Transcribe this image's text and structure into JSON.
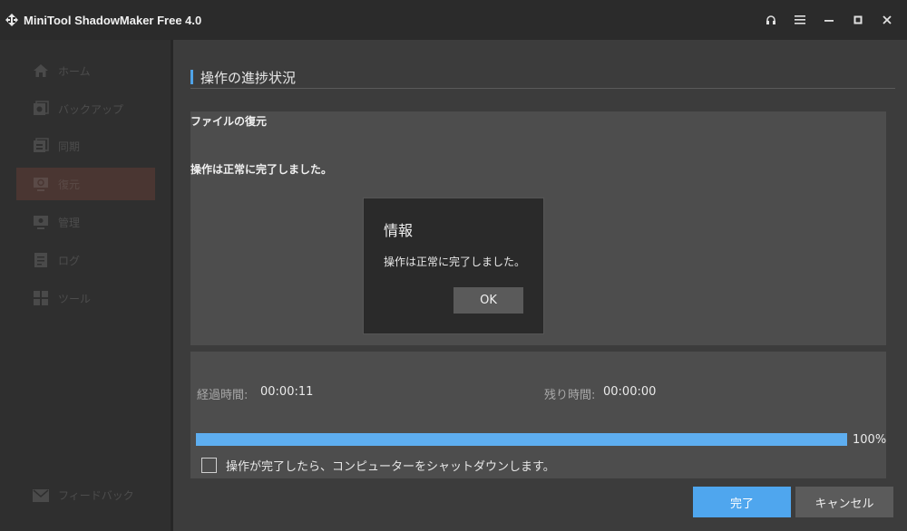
{
  "window": {
    "title": "MiniTool ShadowMaker Free 4.0",
    "controls": [
      "headset-icon",
      "menu-icon",
      "minimize-icon",
      "maximize-icon",
      "close-icon"
    ]
  },
  "sidebar": {
    "items": [
      {
        "label": "ホーム",
        "icon": "home-icon"
      },
      {
        "label": "バックアップ",
        "icon": "backup-icon"
      },
      {
        "label": "同期",
        "icon": "sync-icon"
      },
      {
        "label": "復元",
        "icon": "restore-icon",
        "active": true
      },
      {
        "label": "管理",
        "icon": "manage-icon"
      },
      {
        "label": "ログ",
        "icon": "log-icon"
      },
      {
        "label": "ツール",
        "icon": "tools-icon"
      }
    ],
    "feedback_label": "フィードバック"
  },
  "main": {
    "section_title": "操作の進捗状況",
    "operation_name": "ファイルの復元",
    "operation_status": "操作は正常に完了しました。",
    "elapsed_label": "経過時間:",
    "elapsed_value": "00:00:11",
    "remaining_label": "残り時間:",
    "remaining_value": "00:00:00",
    "progress_percent": 100,
    "progress_text": "100%",
    "shutdown_label": "操作が完了したら、コンピューターをシャットダウンします。",
    "shutdown_checked": false,
    "finish_label": "完了",
    "cancel_label": "キャンセル"
  },
  "dialog": {
    "title": "情報",
    "message": "操作は正常に完了しました。",
    "ok_label": "OK"
  },
  "colors": {
    "accent": "#4fa6ee",
    "active_nav": "#4a3632"
  }
}
